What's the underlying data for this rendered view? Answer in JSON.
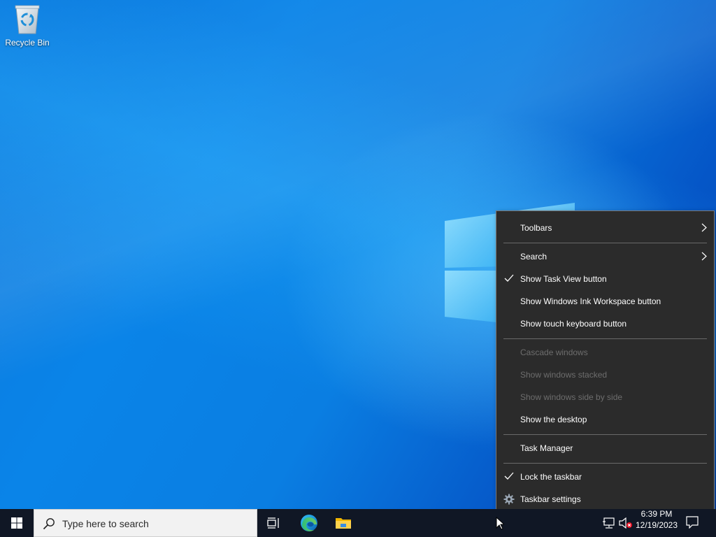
{
  "desktop": {
    "icons": [
      {
        "label": "Recycle Bin",
        "icon": "recycle-bin-icon"
      }
    ]
  },
  "context_menu": {
    "items": [
      {
        "label": "Toolbars",
        "checked": false,
        "enabled": true,
        "submenu": true
      },
      {
        "label": "Search",
        "checked": false,
        "enabled": true,
        "submenu": true
      },
      {
        "label": "Show Task View button",
        "checked": true,
        "enabled": true
      },
      {
        "label": "Show Windows Ink Workspace button",
        "checked": false,
        "enabled": true
      },
      {
        "label": "Show touch keyboard button",
        "checked": false,
        "enabled": true
      },
      {
        "label": "Cascade windows",
        "checked": false,
        "enabled": false
      },
      {
        "label": "Show windows stacked",
        "checked": false,
        "enabled": false
      },
      {
        "label": "Show windows side by side",
        "checked": false,
        "enabled": false
      },
      {
        "label": "Show the desktop",
        "checked": false,
        "enabled": true
      },
      {
        "label": "Task Manager",
        "checked": false,
        "enabled": true
      },
      {
        "label": "Lock the taskbar",
        "checked": true,
        "enabled": true
      },
      {
        "label": "Taskbar settings",
        "checked": false,
        "enabled": true,
        "icon": "gear-icon"
      }
    ]
  },
  "taskbar": {
    "search_placeholder": "Type here to search",
    "pinned": [
      {
        "name": "task-view",
        "icon": "task-view-icon"
      },
      {
        "name": "edge",
        "icon": "edge-icon"
      },
      {
        "name": "file-explorer",
        "icon": "folder-icon"
      }
    ],
    "tray": {
      "time": "6:39 PM",
      "date": "12/19/2023",
      "network_icon": "network-icon",
      "volume_icon": "volume-muted-icon"
    }
  },
  "colors": {
    "menu_bg": "#2b2b2b",
    "taskbar_bg": "#101725",
    "accent": "#0078d7"
  }
}
